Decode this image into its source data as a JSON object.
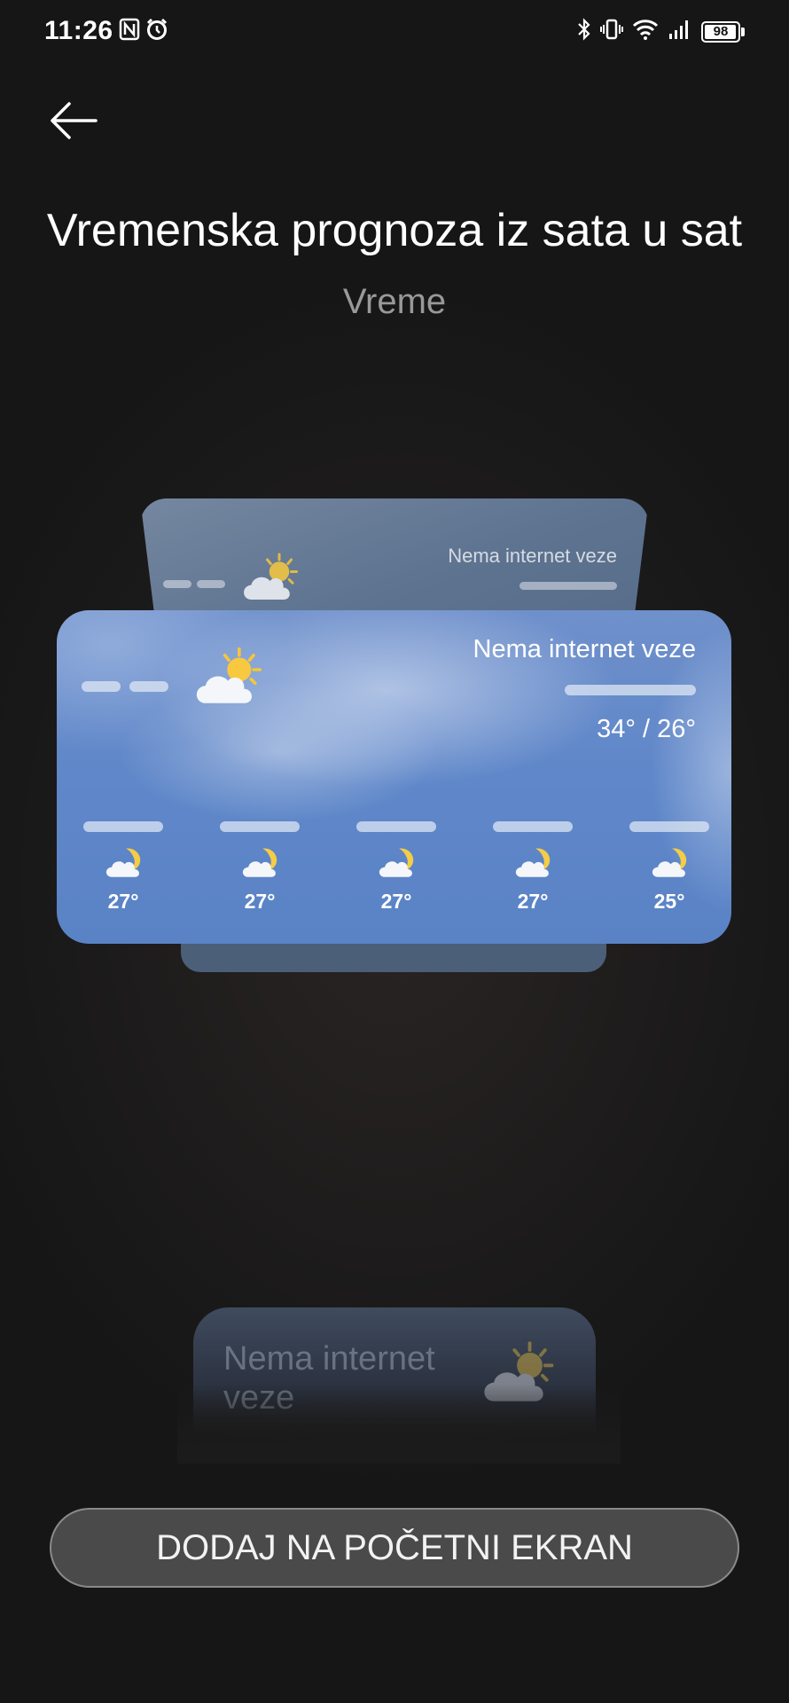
{
  "status_bar": {
    "time": "11:26",
    "battery": "98",
    "left_icons": [
      "nfc-icon",
      "alarm-icon"
    ],
    "right_icons": [
      "bluetooth-icon",
      "vibrate-icon",
      "wifi-icon",
      "signal-icon",
      "battery-icon"
    ]
  },
  "header": {
    "back_icon": "back-arrow-icon",
    "title": "Vremenska prognoza iz sata u sat",
    "subtitle": "Vreme"
  },
  "widget_back": {
    "status": "Nema internet veze",
    "icon": "partly-cloudy-sun-icon"
  },
  "widget_main": {
    "status": "Nema internet veze",
    "temps": "34° / 26°",
    "icon": "partly-cloudy-sun-icon",
    "hourly": [
      {
        "temp": "27°",
        "icon": "cloudy-night-moon-icon"
      },
      {
        "temp": "27°",
        "icon": "cloudy-night-moon-icon"
      },
      {
        "temp": "27°",
        "icon": "cloudy-night-moon-icon"
      },
      {
        "temp": "27°",
        "icon": "cloudy-night-moon-icon"
      },
      {
        "temp": "25°",
        "icon": "cloudy-night-moon-icon"
      }
    ]
  },
  "widget_faded": {
    "status": "Nema internet veze",
    "icon": "partly-cloudy-sun-icon"
  },
  "actions": {
    "add_label": "DODAJ NA POČETNI EKRAN"
  },
  "colors": {
    "background": "#1c1b1b",
    "card_blue": "#5f87c9",
    "button_bg": "#4a4a4a"
  }
}
